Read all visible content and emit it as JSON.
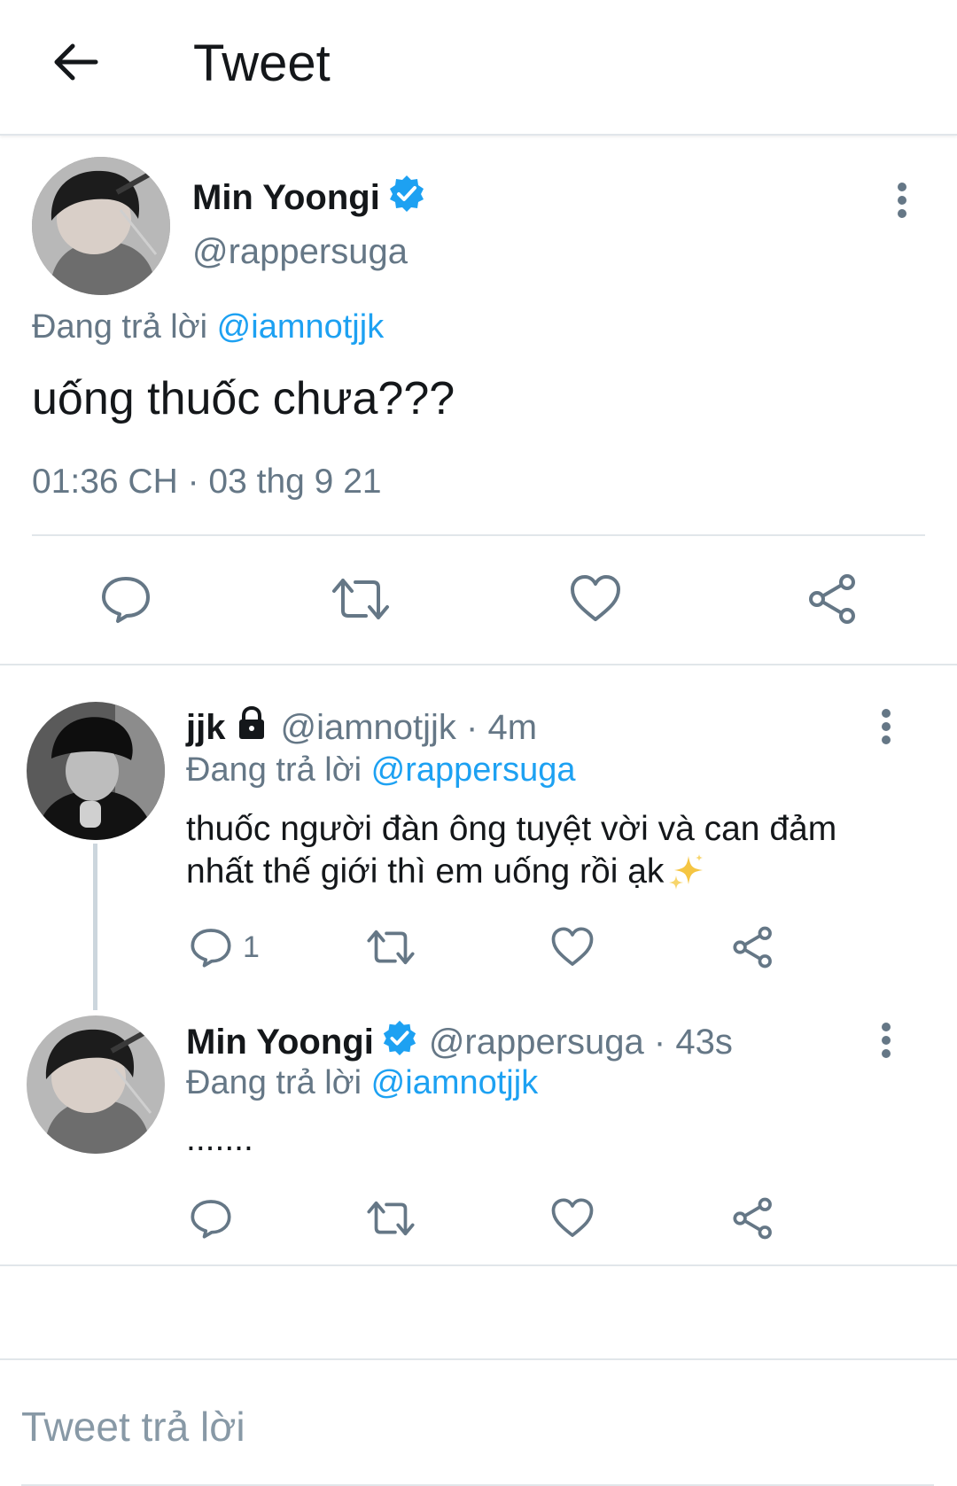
{
  "header": {
    "title": "Tweet"
  },
  "main_tweet": {
    "name": "Min Yoongi",
    "handle": "@rappersuga",
    "replying_prefix": "Đang trả lời",
    "replying_to": "@iamnotjjk",
    "text": "uống thuốc chưa???",
    "timestamp": "01:36 CH · 03 thg 9 21"
  },
  "replies": [
    {
      "name": "jjk",
      "handle": "@iamnotjjk · 4m",
      "replying_prefix": "Đang trả lời",
      "replying_to": "@rappersuga",
      "text_line1": "thuốc người đàn ông tuyệt vời và can đảm",
      "text_line2": "nhất thế giới thì em uống rồi ạk",
      "reply_count": "1"
    },
    {
      "name": "Min Yoongi",
      "handle": "@rappersuga · 43s",
      "replying_prefix": "Đang trả lời",
      "replying_to": "@iamnotjjk",
      "text": ".......",
      "reply_count": ""
    }
  ],
  "compose": {
    "placeholder": "Tweet trả lời"
  },
  "colors": {
    "accent": "#1da1f2",
    "secondary_text": "#657786",
    "icon": "#657786"
  }
}
